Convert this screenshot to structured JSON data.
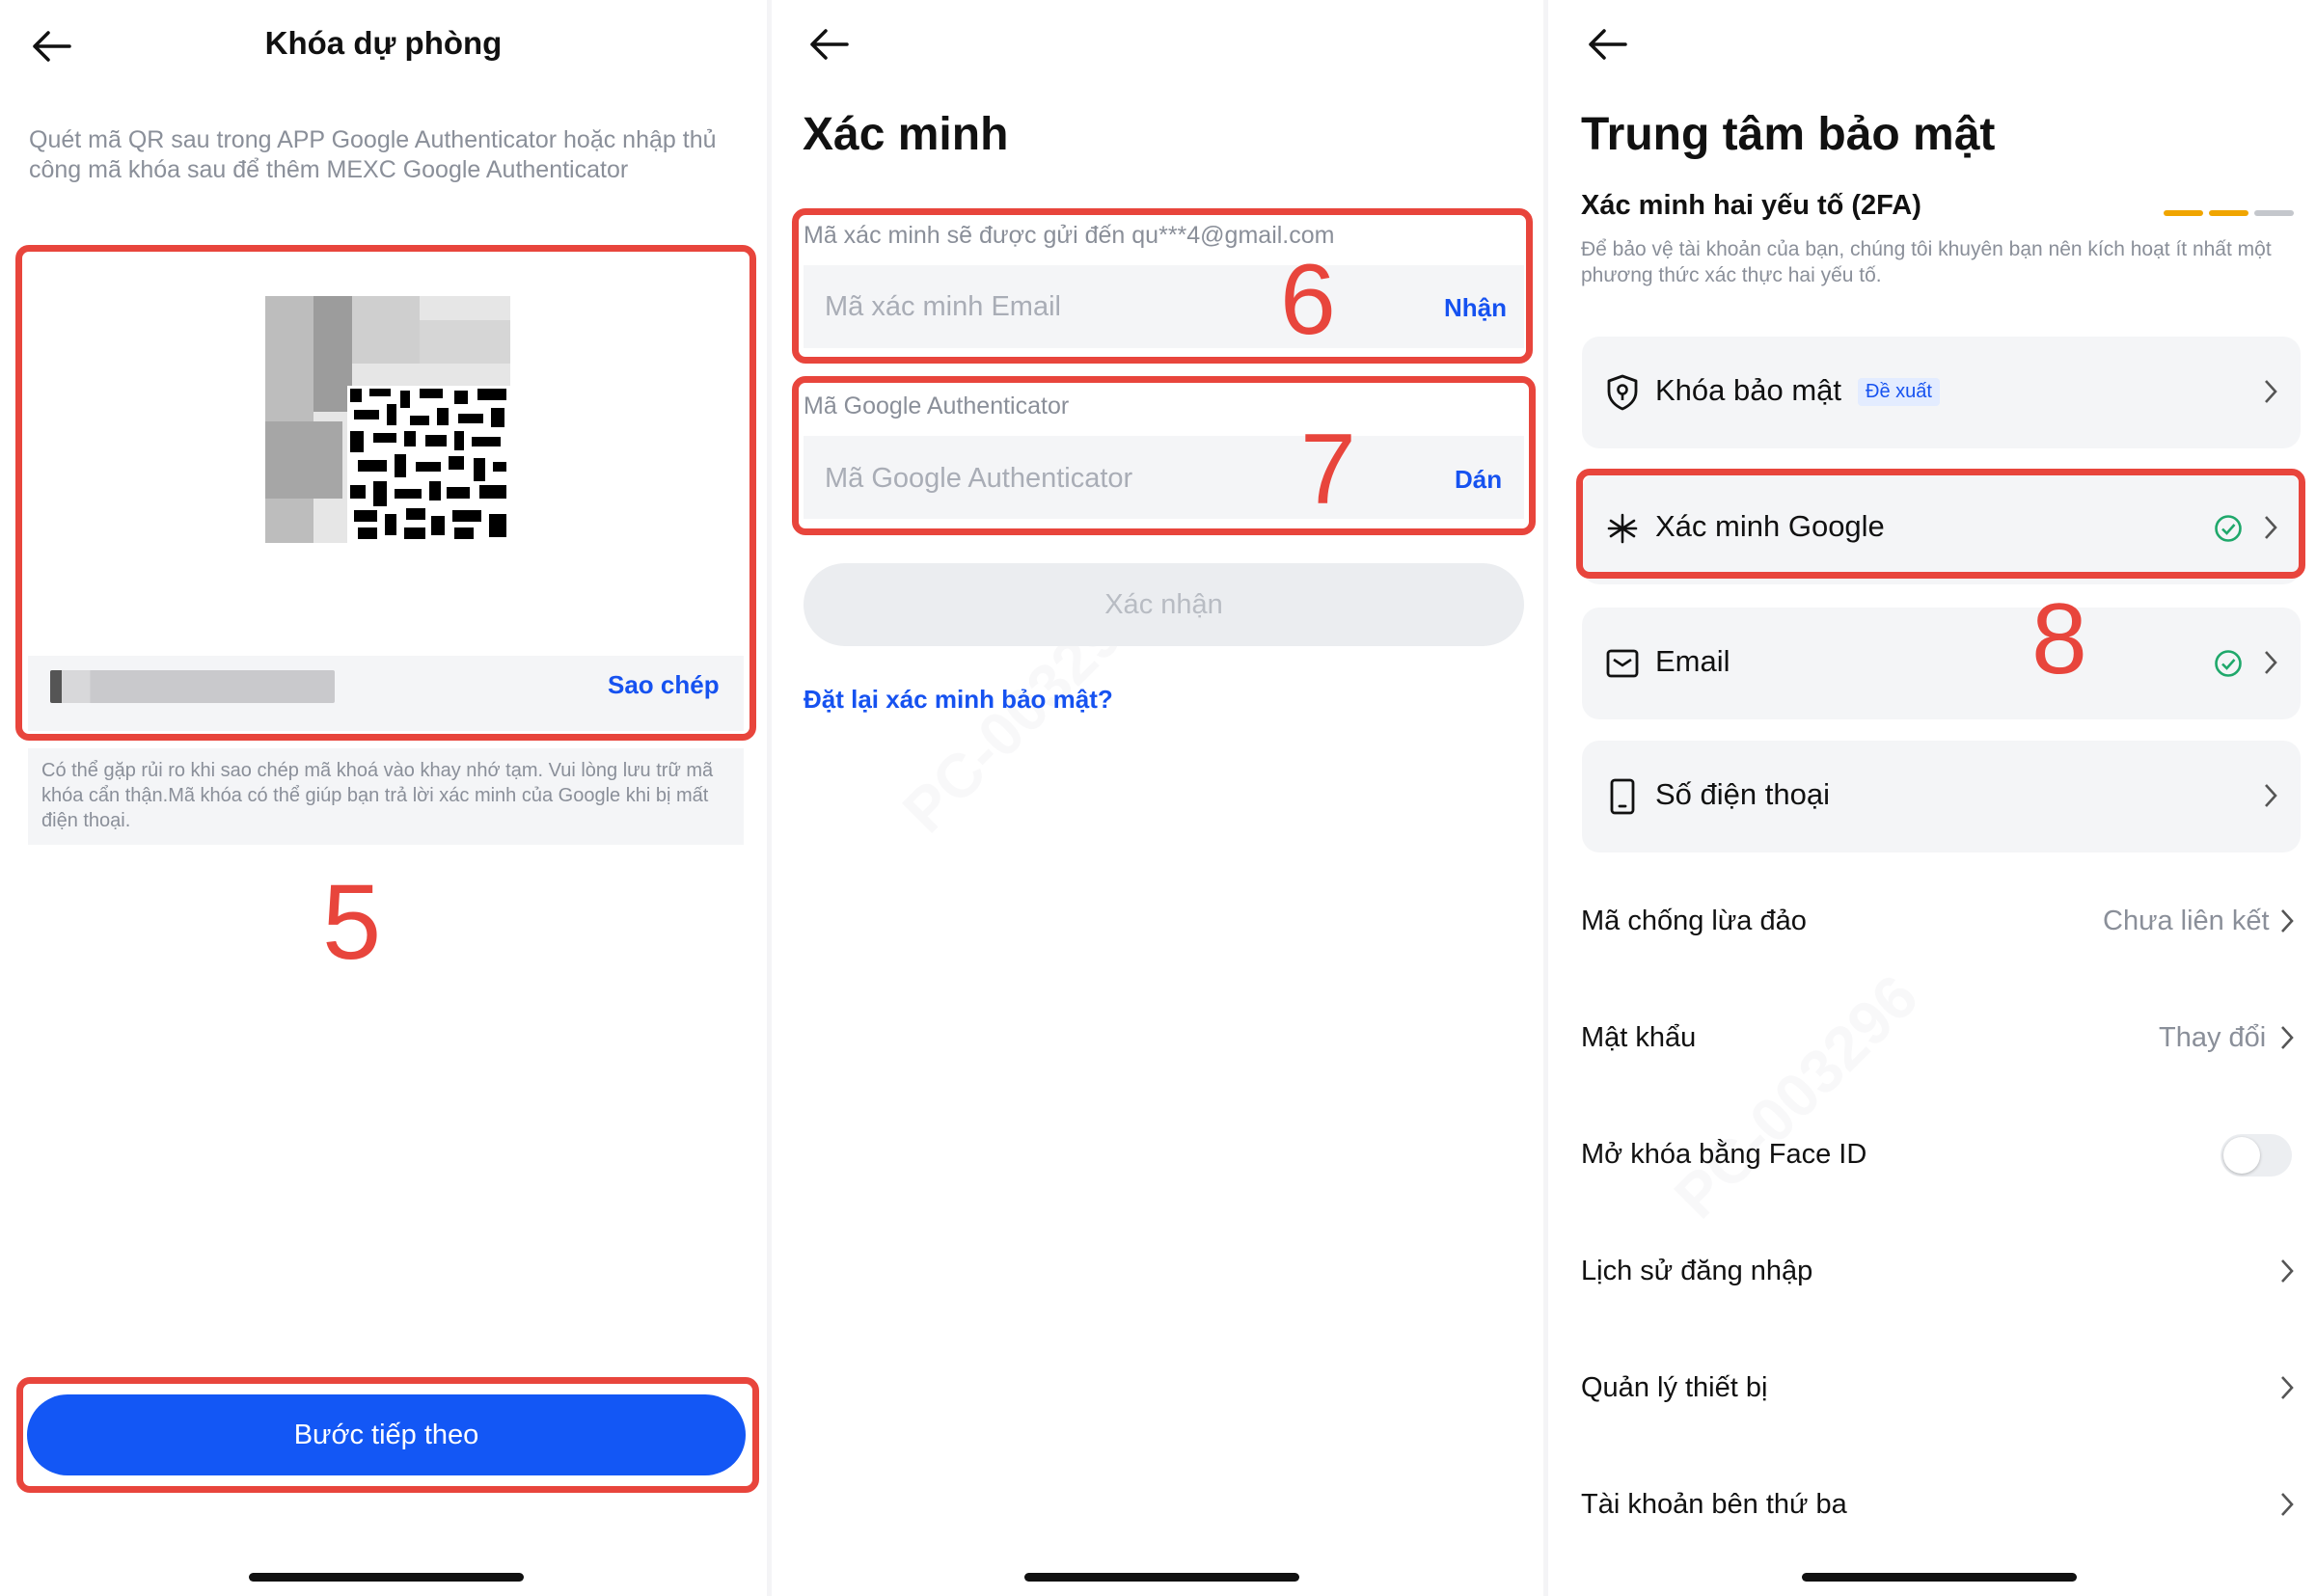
{
  "panel1": {
    "title": "Khóa dự phòng",
    "description": "Quét mã QR sau trong APP Google Authenticator hoặc nhập thủ công mã khóa sau để thêm MEXC Google Authenticator",
    "copy_label": "Sao chép",
    "warning": "Có thể gặp rủi ro khi sao chép mã khoá vào khay nhớ tạm. Vui lòng lưu trữ mã khóa cẩn thận.Mã khóa có thể giúp bạn trả lời xác minh của Google khi bị mất điện thoại.",
    "step_number": "5",
    "next_button": "Bước tiếp theo"
  },
  "panel2": {
    "title": "Xác minh",
    "email_label": "Mã xác minh sẽ được gửi đến qu***4@gmail.com",
    "email_placeholder": "Mã xác minh Email",
    "email_button": "Nhận",
    "email_step": "6",
    "google_label": "Mã Google Authenticator",
    "google_placeholder": "Mã Google Authenticator",
    "google_button": "Dán",
    "google_step": "7",
    "confirm_button": "Xác nhận",
    "reset_link": "Đặt lại xác minh bảo mật?"
  },
  "panel3": {
    "title": "Trung tâm bảo mật",
    "twofa_title": "Xác minh hai yếu tố (2FA)",
    "twofa_desc": "Để bảo vệ tài khoản của bạn, chúng tôi khuyên bạn nên kích hoạt ít nhất một phương thức xác thực hai yếu tố.",
    "strength_colors": [
      "#f0a500",
      "#f0a500",
      "#c4c7cc"
    ],
    "cards": [
      {
        "label": "Khóa bảo mật",
        "badge": "Đề xuất",
        "icon": "shield-key-icon",
        "verified": false
      },
      {
        "label": "Xác minh Google",
        "icon": "asterisk-icon",
        "verified": true
      },
      {
        "label": "Email",
        "icon": "mail-icon",
        "verified": true
      },
      {
        "label": "Số điện thoại",
        "icon": "phone-icon",
        "verified": false
      }
    ],
    "step_number": "8",
    "rows": [
      {
        "label": "Mã chống lừa đảo",
        "value": "Chưa liên kết"
      },
      {
        "label": "Mật khẩu",
        "value": "Thay đổi"
      },
      {
        "label": "Mở khóa bằng Face ID",
        "toggle": false
      },
      {
        "label": "Lịch sử đăng nhập"
      },
      {
        "label": "Quản lý thiết bị"
      },
      {
        "label": "Tài khoản bên thứ ba"
      }
    ]
  },
  "colors": {
    "accent": "#1357f5",
    "highlight": "#e8453c",
    "success": "#1fa86b"
  }
}
